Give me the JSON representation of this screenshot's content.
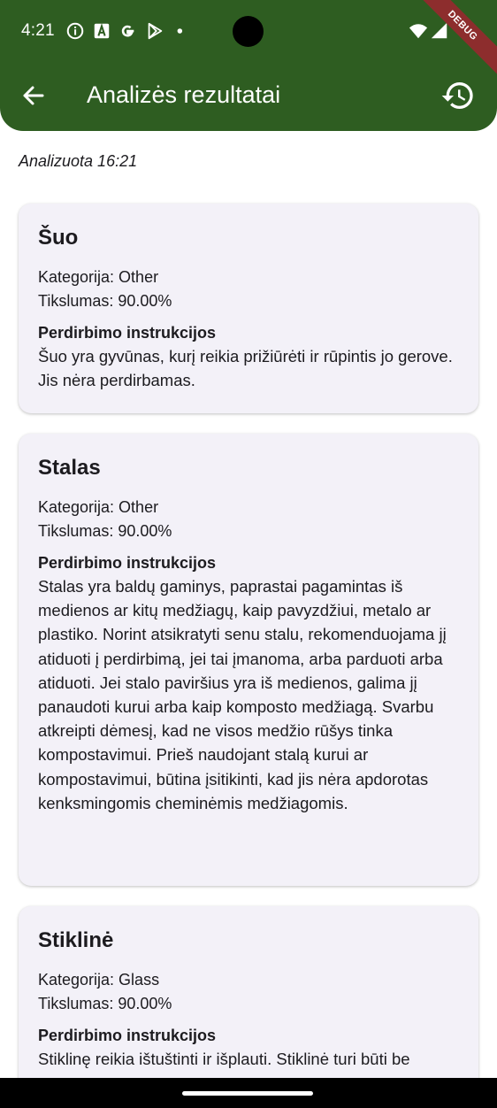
{
  "status_bar": {
    "time": "4:21",
    "left_icons": [
      "info-icon",
      "a-icon",
      "google-icon",
      "play-icon",
      "dot-icon"
    ],
    "right_icons": [
      "wifi-icon",
      "signal-icon",
      "battery-icon"
    ],
    "debug_label": "DEBUG"
  },
  "app_bar": {
    "title": "Analizės rezultatai",
    "bg_color": "#2e5d21"
  },
  "analyzed_label": "Analizuota 16:21",
  "results": [
    {
      "name": "Šuo",
      "category": "Kategorija: Other",
      "accuracy": "Tikslumas: 90.00%",
      "instructions_title": "Perdirbimo instrukcijos",
      "instructions": "Šuo yra gyvūnas, kurį reikia prižiūrėti ir rūpintis jo gerove. Jis nėra perdirbamas."
    },
    {
      "name": "Stalas",
      "category": "Kategorija: Other",
      "accuracy": "Tikslumas: 90.00%",
      "instructions_title": "Perdirbimo instrukcijos",
      "instructions": "Stalas yra baldų gaminys, paprastai pagamintas iš medienos ar kitų medžiagų, kaip pavyzdžiui, metalo ar plastiko.  Norint atsikratyti senu stalu, rekomenduojama jį atiduoti į perdirbimą, jei tai įmanoma, arba parduoti arba atiduoti. Jei  stalo paviršius yra iš medienos, galima jį panaudoti kurui arba kaip komposto medžiagą. Svarbu atkreipti dėmesį, kad ne visos medžio rūšys tinka kompostavimui. Prieš naudojant stalą kurui ar kompostavimui, būtina įsitikinti, kad jis nėra apdorotas kenksmingomis cheminėmis medžiagomis."
    },
    {
      "name": "Stiklinė",
      "category": "Kategorija: Glass",
      "accuracy": "Tikslumas: 90.00%",
      "instructions_title": "Perdirbimo instrukcijos",
      "instructions": "Stiklinę reikia ištuštinti ir išplauti.  Stiklinė turi būti be"
    }
  ]
}
